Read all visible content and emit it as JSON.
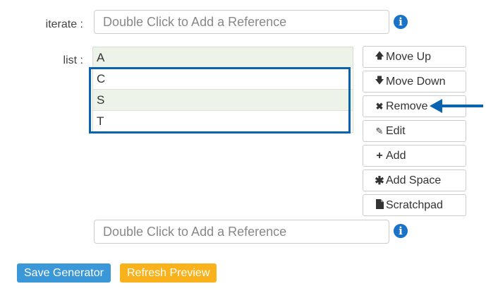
{
  "iterate": {
    "label": "iterate :",
    "placeholder": "Double Click to Add a Reference"
  },
  "list": {
    "label": "list :",
    "items": [
      "A",
      "C",
      "S",
      "T"
    ]
  },
  "buttons": {
    "move_up": "Move Up",
    "move_down": "Move Down",
    "remove": "Remove",
    "edit": "Edit",
    "add": "Add",
    "add_space": "Add Space",
    "scratchpad": "Scratchpad"
  },
  "bottom_reference": {
    "placeholder": "Double Click to Add a Reference"
  },
  "actions": {
    "save_generator": "Save Generator",
    "refresh_preview": "Refresh Preview"
  },
  "colors": {
    "info": "#1a73c8",
    "highlight": "#0a63b0",
    "save": "#3a97d8",
    "refresh": "#f9b21c"
  }
}
